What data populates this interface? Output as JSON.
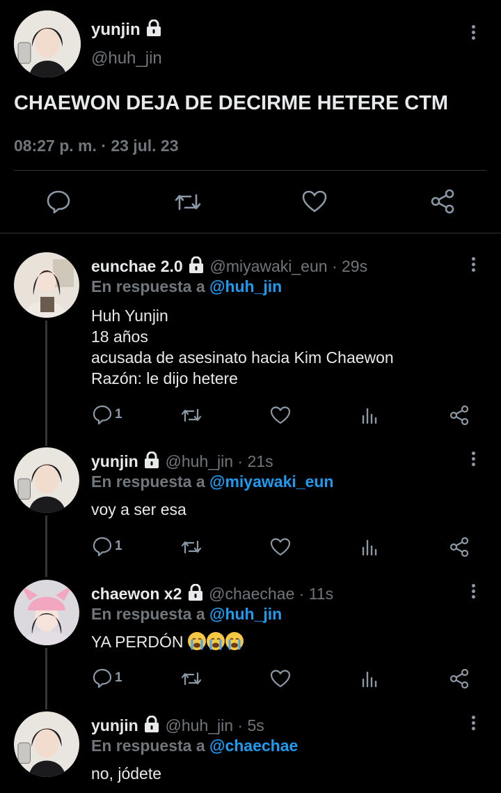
{
  "main_tweet": {
    "name": "yunjin",
    "handle": "@huh_jin",
    "text": "CHAEWON DEJA DE DECIRME HETERE CTM",
    "meta": "08:27 p. m. · 23 jul. 23"
  },
  "replies": [
    {
      "name": "eunchae 2.0",
      "handle_time": "@miyawaki_eun · 29s",
      "reply_prefix": "En respuesta a",
      "reply_to": "@huh_jin",
      "lines": [
        "Huh Yunjin",
        "18 años",
        "acusada de asesinato hacia Kim Chaewon",
        "Razón: le dijo hetere"
      ],
      "reply_count": "1"
    },
    {
      "name": "yunjin",
      "handle_time": "@huh_jin · 21s",
      "reply_prefix": "En respuesta a",
      "reply_to": "@miyawaki_eun",
      "lines": [
        "voy a ser esa"
      ],
      "reply_count": "1"
    },
    {
      "name": "chaewon x2",
      "handle_time": "@chaechae · 11s",
      "reply_prefix": "En respuesta a",
      "reply_to": "@huh_jin",
      "text": "YA PERDÓN",
      "reply_count": "1"
    },
    {
      "name": "yunjin",
      "handle_time": "@huh_jin · 5s",
      "reply_prefix": "En respuesta a",
      "reply_to": "@chaechae",
      "lines": [
        "no, jódete"
      ]
    }
  ],
  "icons": [
    "lock-icon",
    "more-icon",
    "reply-icon",
    "retweet-icon",
    "like-icon",
    "share-icon",
    "views-icon",
    "crying-emoji-icon"
  ],
  "colors": {
    "background": "#000000",
    "text": "#e7e9ea",
    "muted": "#71767b",
    "link": "#1d9bf0",
    "divider": "#2f3336"
  }
}
